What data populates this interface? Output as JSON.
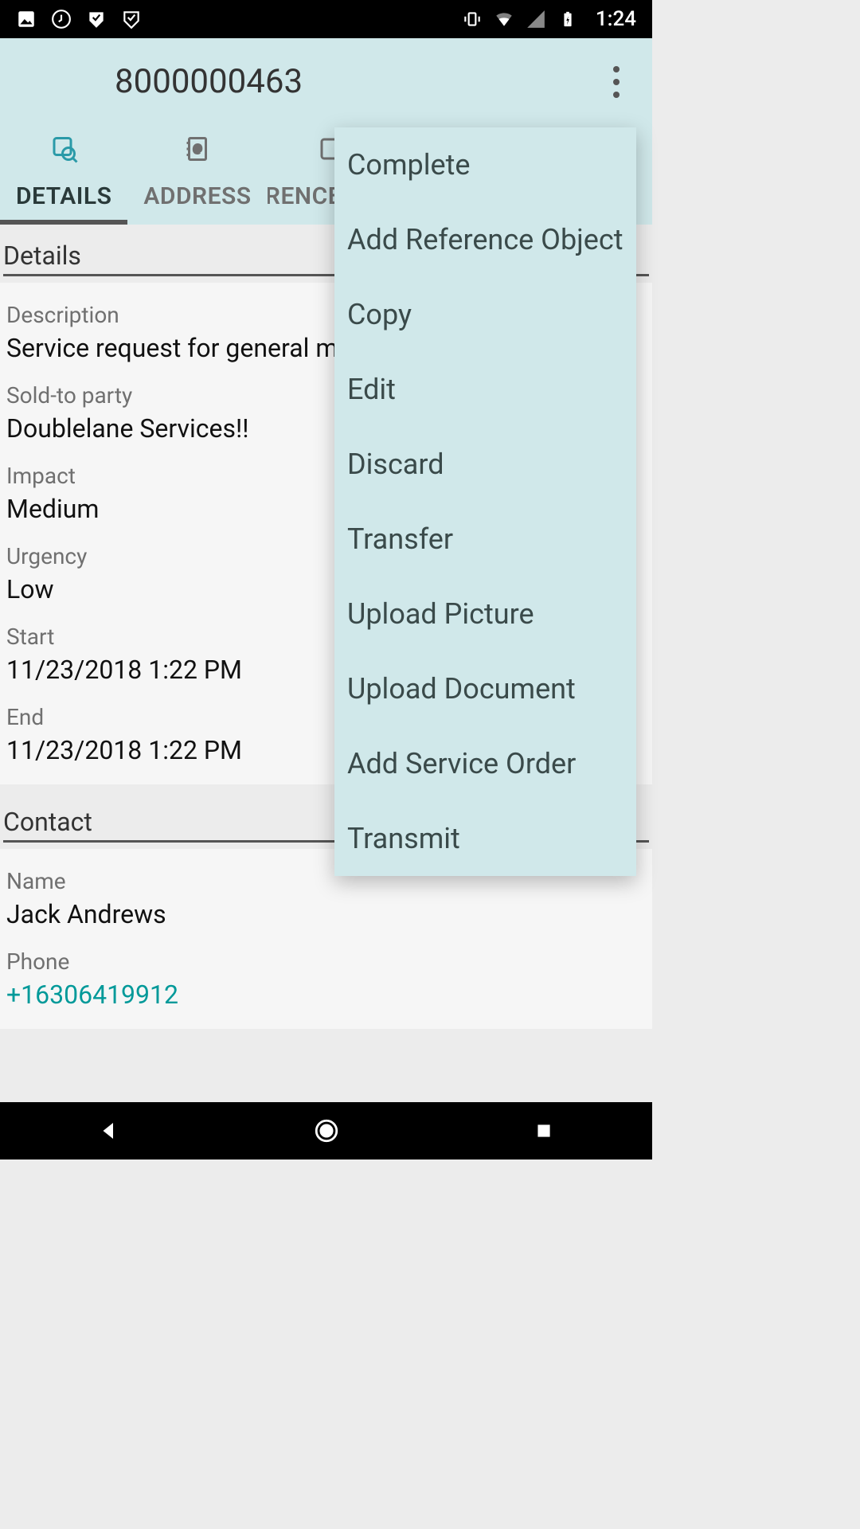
{
  "status_bar": {
    "time": "1:24"
  },
  "header": {
    "title": "8000000463"
  },
  "tabs": [
    {
      "label": "DETAILS",
      "active": true
    },
    {
      "label": "ADDRESS",
      "active": false
    },
    {
      "label": "REFERENCE OBJECTS",
      "active": false
    }
  ],
  "details_section": {
    "header": "Details",
    "description_label": "Description",
    "description_value": "Service request for general maintenance",
    "sold_to_label": "Sold-to party",
    "sold_to_value": "Doublelane Services!!",
    "impact_label": "Impact",
    "impact_value": "Medium",
    "urgency_label": "Urgency",
    "urgency_value": "Low",
    "start_label": "Start",
    "start_value": "11/23/2018 1:22 PM",
    "end_label": "End",
    "end_value": "11/23/2018 1:22 PM"
  },
  "contact_section": {
    "header": "Contact",
    "name_label": "Name",
    "name_value": "Jack Andrews",
    "phone_label": "Phone",
    "phone_value": "+16306419912"
  },
  "menu": {
    "complete": "Complete",
    "add_reference": "Add Reference Object",
    "copy": "Copy",
    "edit": "Edit",
    "discard": "Discard",
    "transfer": "Transfer",
    "upload_picture": "Upload Picture",
    "upload_document": "Upload Document",
    "add_service_order": "Add Service Order",
    "transmit": "Transmit"
  }
}
